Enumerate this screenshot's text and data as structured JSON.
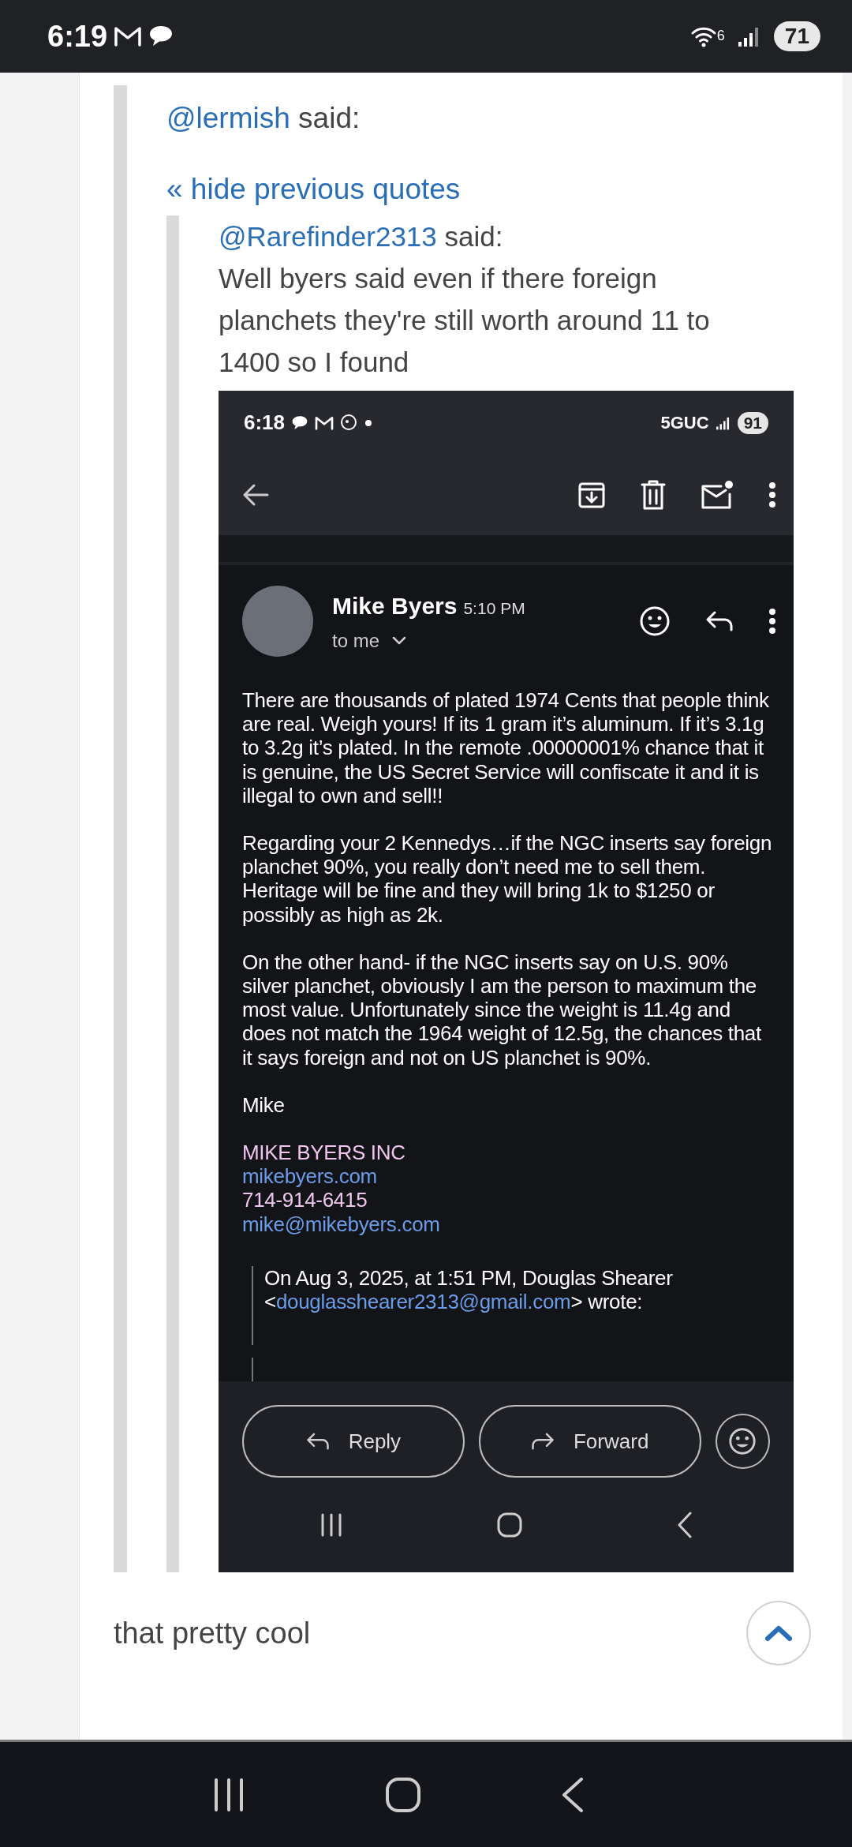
{
  "status_bar": {
    "time": "6:19",
    "wifi_label": "6",
    "battery": "71"
  },
  "quote": {
    "author": "@lermish",
    "said": " said:",
    "toggle": "« hide previous quotes",
    "nested_quote": {
      "author": "@Rarefinder2313",
      "said": " said:",
      "text": "Well byers said even if there foreign planchets they're still worth around 11 to 1400 so I found",
      "attachment": {
        "status_bar": {
          "time": "6:18",
          "network": "5GUC",
          "battery": "91"
        },
        "sender": "Mike Byers",
        "sent_time": "5:10 PM",
        "recipient": "to me",
        "body": [
          "There are thousands of plated 1974 Cents that people think are real. Weigh yours! If its 1 gram it’s aluminum. If it’s 3.1g to 3.2g it’s plated. In the remote .00000001% chance that it is genuine, the US Secret Service will confiscate it and it is illegal to own and sell!!",
          "Regarding your 2 Kennedys…if the NGC inserts say foreign planchet 90%, you really don’t need me to sell them. Heritage will be fine and they will bring 1k to $1250 or possibly as high as 2k.",
          "On the other hand- if the NGC inserts say on U.S. 90% silver planchet, obviously I am the person to maximum the most value.  Unfortunately since the weight is 11.4g and does not match the 1964 weight of 12.5g, the chances that it says foreign and not on US planchet is 90%.",
          "Mike"
        ],
        "signature": [
          {
            "text": "MIKE BYERS INC",
            "kind": "text"
          },
          {
            "text": "mikebyers.com",
            "kind": "link"
          },
          {
            "text": "714-914-6415",
            "kind": "text"
          },
          {
            "text": "mike@mikebyers.com",
            "kind": "link"
          }
        ],
        "quoted": {
          "before": "On Aug 3, 2025, at 1:51 PM, Douglas Shearer <",
          "link": "douglasshearer2313@gmail.com",
          "after": "> wrote:"
        },
        "actions": [
          {
            "label": "Reply",
            "kind": "reply"
          },
          {
            "label": "Forward",
            "kind": "forward"
          }
        ]
      }
    }
  },
  "reply_text": "that pretty cool"
}
